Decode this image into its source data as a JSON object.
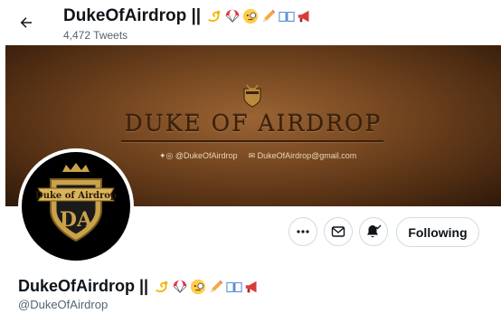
{
  "header": {
    "title": "DukeOfAirdrop ||",
    "tweet_count": "4,472 Tweets"
  },
  "name_emojis": [
    "dizzy-emoji",
    "parachute-emoji",
    "monocle-face-emoji",
    "pencil-emoji",
    "open-book-emoji",
    "megaphone-emoji"
  ],
  "banner": {
    "headline": "DUKE OF AIRDROP",
    "social_handle": "@DukeOfAirdrop",
    "email": "DukeOfAirdrop@gmail.com"
  },
  "avatar": {
    "ribbon_text": "Duke of Airdrop",
    "monogram": "DA"
  },
  "actions": {
    "follow_label": "Following"
  },
  "profile": {
    "display_name": "DukeOfAirdrop ||",
    "handle": "@DukeOfAirdrop"
  },
  "colors": {
    "text": "#0f1419",
    "secondary_text": "#536471",
    "border": "#cfd9de",
    "banner_brown": "#7a4a22",
    "gold": "#c9a24a"
  }
}
